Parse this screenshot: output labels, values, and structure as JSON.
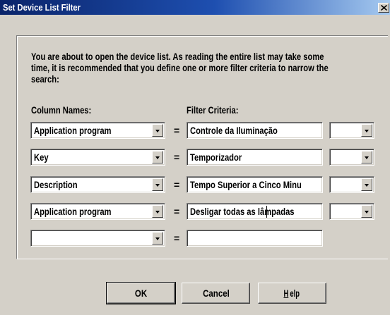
{
  "window": {
    "title": "Set Device List Filter"
  },
  "intro": {
    "lines": [
      "You are about to open the device list. As reading the entire list may take some",
      "time, it is recommended that you define one or more filter criteria to narrow the",
      "search:"
    ]
  },
  "headers": {
    "column_names": "Column Names:",
    "filter_criteria": "Filter Criteria:"
  },
  "equals_sign": "=",
  "rows": [
    {
      "column": "Application program",
      "criteria": "Controle da Iluminação",
      "operator": ""
    },
    {
      "column": "Key",
      "criteria": "Temporizador",
      "operator": ""
    },
    {
      "column": "Description",
      "criteria": "Tempo Superior a Cinco Minu",
      "operator": ""
    },
    {
      "column": "Application program",
      "criteria": "Desligar todas as lâmpadas",
      "operator": ""
    },
    {
      "column": "",
      "criteria": ""
    }
  ],
  "buttons": {
    "ok": "OK",
    "cancel": "Cancel",
    "help_mnemonic": "H",
    "help_rest": "elp"
  },
  "icons": {
    "close": "close-icon",
    "dropdown": "chevron-down-icon"
  },
  "colors": {
    "titlebar": "#0a246a",
    "face": "#d4d0c8",
    "field": "#ffffff"
  }
}
